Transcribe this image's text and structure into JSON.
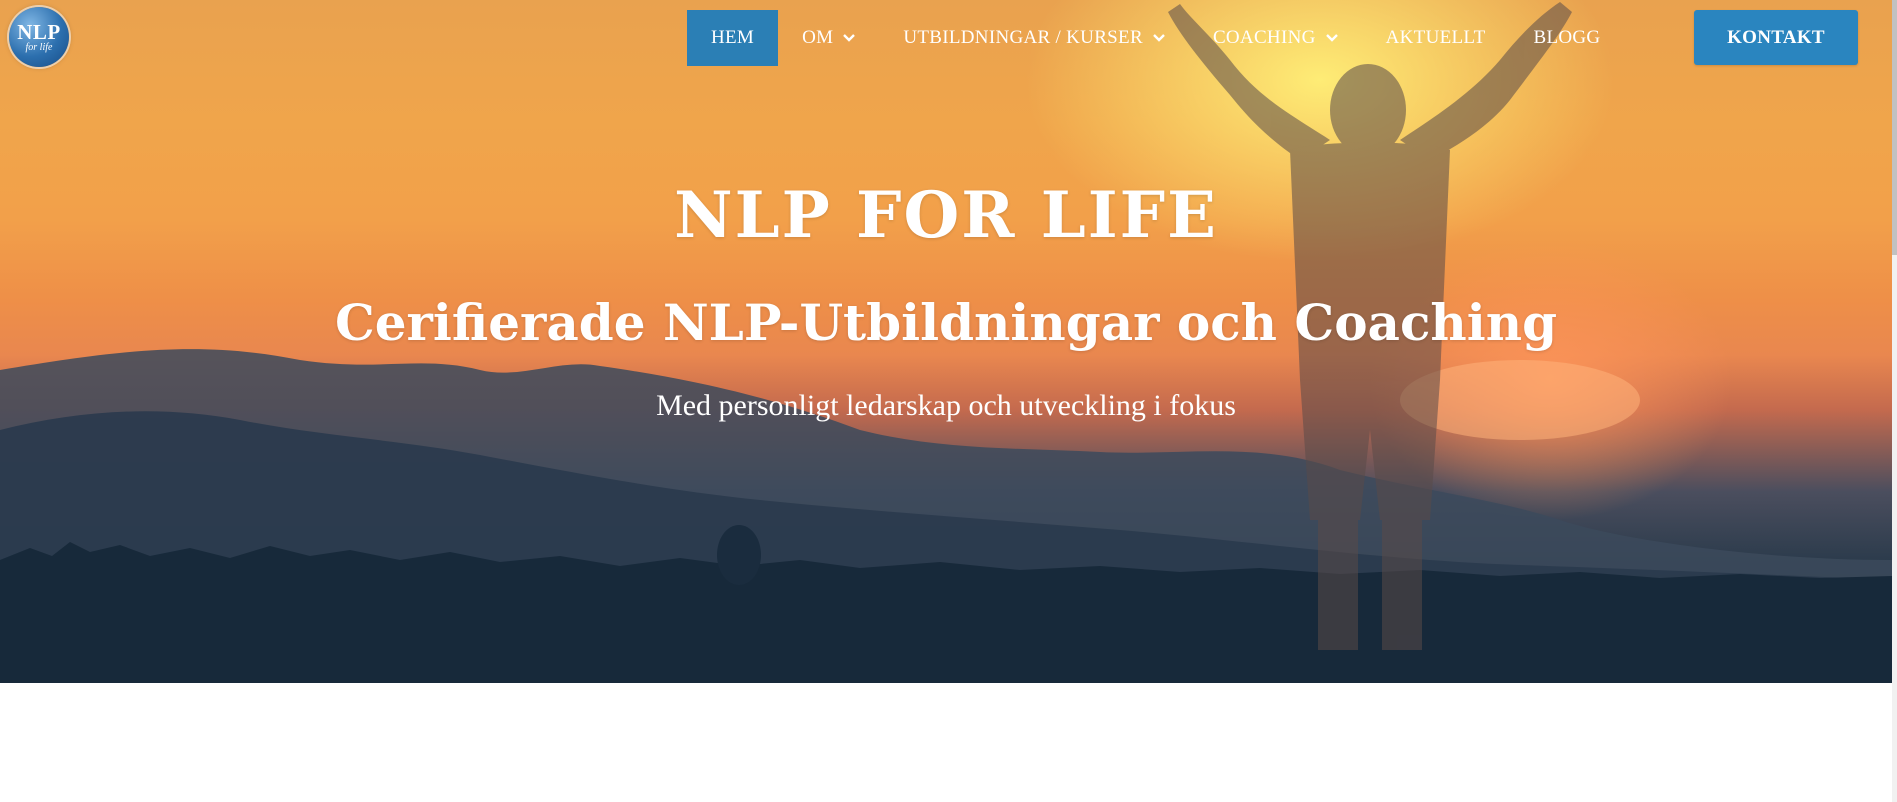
{
  "logo": {
    "line1": "NLP",
    "line2": "for life"
  },
  "nav": {
    "items": [
      {
        "label": "HEM",
        "active": true,
        "dropdown": false
      },
      {
        "label": "OM",
        "active": false,
        "dropdown": true
      },
      {
        "label": "UTBILDNINGAR / KURSER",
        "active": false,
        "dropdown": true
      },
      {
        "label": "COACHING",
        "active": false,
        "dropdown": true
      },
      {
        "label": "AKTUELLT",
        "active": false,
        "dropdown": false
      },
      {
        "label": "BLOGG",
        "active": false,
        "dropdown": false
      }
    ],
    "cta_label": "KONTAKT"
  },
  "hero": {
    "title": "NLP FOR LIFE",
    "subtitle": "Cerifierade NLP-Utbildningar och Coaching",
    "tagline": "Med personligt ledarskap och utveckling i fokus"
  },
  "colors": {
    "accent": "#2b7fb5",
    "cta": "#2a85bf",
    "text": "#ffffff"
  },
  "icons": {
    "dropdown": "chevron-down-icon"
  }
}
